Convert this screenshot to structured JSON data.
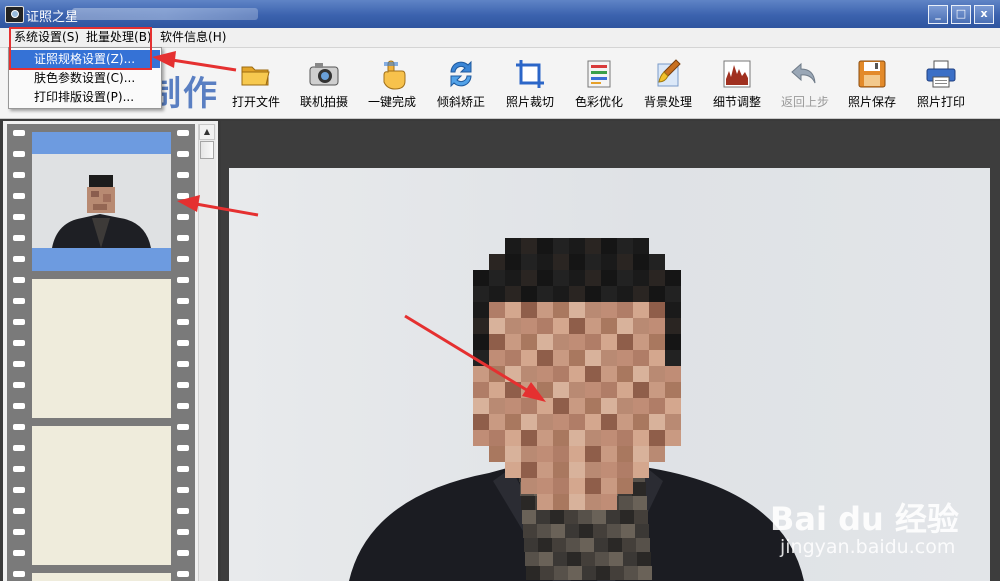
{
  "window": {
    "title": "证照之星",
    "controls": {
      "minimize": "_",
      "maximize": "□",
      "close": "x"
    }
  },
  "menubar": [
    {
      "label": "系统设置",
      "accel": "(S)"
    },
    {
      "label": "批量处理",
      "accel": "(B)"
    },
    {
      "label": "软件信息",
      "accel": "(H)"
    }
  ],
  "dropdown": {
    "items": [
      {
        "label": "证照规格设置(Z)...",
        "selected": true
      },
      {
        "label": "肤色参数设置(C)..."
      },
      {
        "label": "打印排版设置(P)..."
      }
    ]
  },
  "logo_text": "制作",
  "toolbar": [
    {
      "label": "打开文件",
      "icon": "folder-icon"
    },
    {
      "label": "联机拍摄",
      "icon": "camera-icon"
    },
    {
      "label": "一键完成",
      "icon": "hand-click-icon"
    },
    {
      "label": "倾斜矫正",
      "icon": "rotate-arrows-icon"
    },
    {
      "label": "照片裁切",
      "icon": "crop-icon"
    },
    {
      "label": "色彩优化",
      "icon": "color-bars-icon"
    },
    {
      "label": "背景处理",
      "icon": "brush-icon"
    },
    {
      "label": "细节调整",
      "icon": "histogram-icon"
    },
    {
      "label": "返回上步",
      "icon": "undo-icon",
      "disabled": true
    },
    {
      "label": "照片保存",
      "icon": "floppy-disk-icon"
    },
    {
      "label": "照片打印",
      "icon": "printer-icon"
    }
  ],
  "colors": {
    "titlebar": "#3b62ae",
    "menu_selection": "#3572d6",
    "annotation_red": "#e53030",
    "logo_blue": "#5a7fc2",
    "thumbnail_bg": "#6d9be0"
  },
  "watermark": {
    "brand": "Bai du 经验",
    "url": "jingyan.baidu.com"
  }
}
